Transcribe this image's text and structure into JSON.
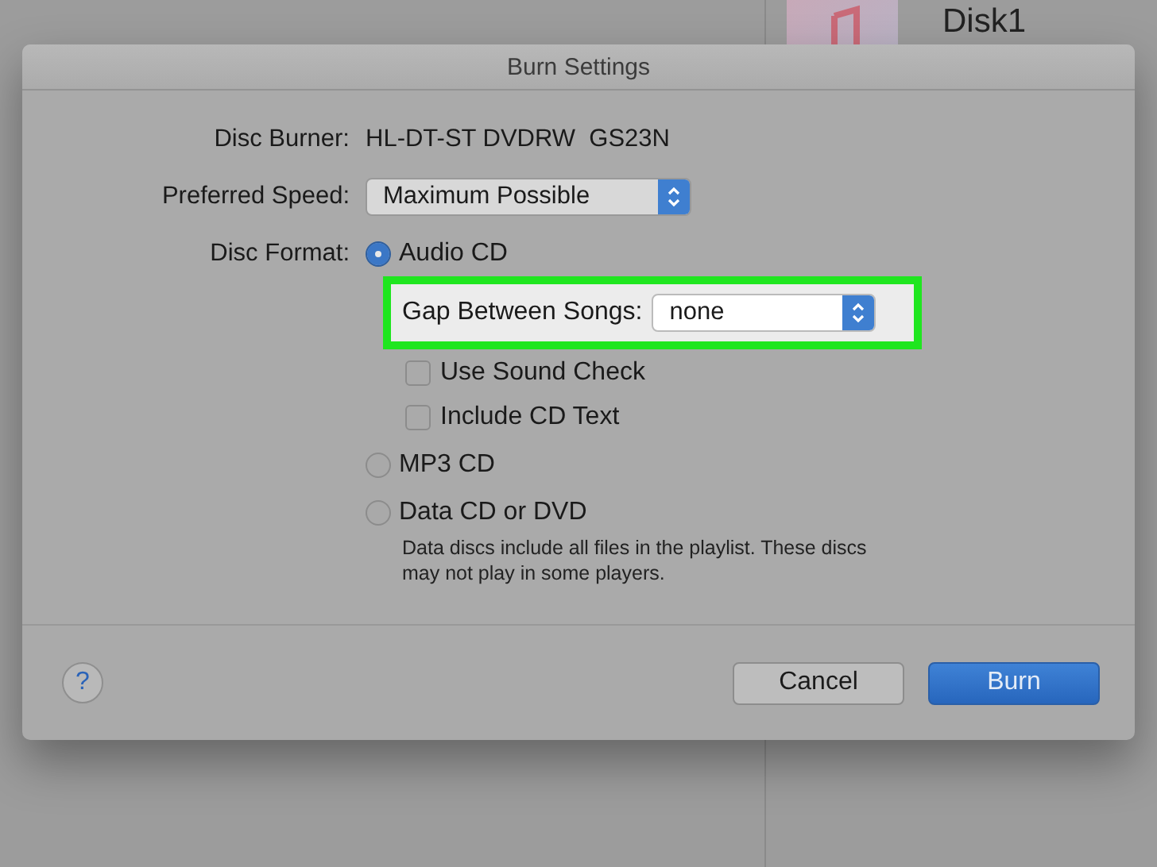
{
  "background": {
    "album_title": "Disk1"
  },
  "dialog": {
    "title": "Burn Settings",
    "disc_burner": {
      "label": "Disc Burner:",
      "value": "HL-DT-ST DVDRW  GS23N"
    },
    "preferred_speed": {
      "label": "Preferred Speed:",
      "value": "Maximum Possible"
    },
    "disc_format": {
      "label": "Disc Format:",
      "options": [
        {
          "kind": "audio",
          "label": "Audio CD",
          "selected": true,
          "gap_between_songs": {
            "label": "Gap Between Songs:",
            "value": "none"
          },
          "checkboxes": [
            {
              "label": "Use Sound Check",
              "checked": false
            },
            {
              "label": "Include CD Text",
              "checked": false
            }
          ]
        },
        {
          "kind": "plain",
          "label": "MP3 CD",
          "selected": false
        },
        {
          "kind": "data",
          "label": "Data CD or DVD",
          "selected": false,
          "description": "Data discs include all files in the playlist. These discs may not play in some players."
        }
      ]
    },
    "help_button": "?",
    "buttons": [
      {
        "label": "Cancel",
        "default": false
      },
      {
        "label": "Burn",
        "default": true
      }
    ]
  }
}
